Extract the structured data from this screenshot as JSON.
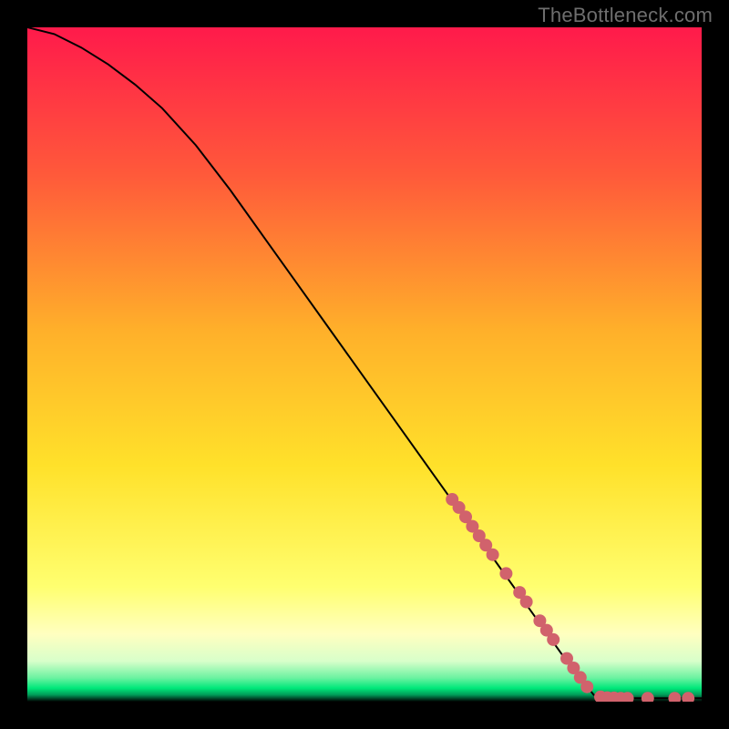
{
  "watermark": "TheBottleneck.com",
  "chart_data": {
    "type": "line",
    "title": "",
    "xlabel": "",
    "ylabel": "",
    "xlim": [
      0,
      100
    ],
    "ylim": [
      0,
      100
    ],
    "grid": false,
    "background_gradient": {
      "top": "#ff1a4b",
      "upper_mid": "#ff8a2a",
      "mid": "#ffe12a",
      "lower_mid": "#ffff8a",
      "bottom_band": "#00e87a",
      "bottom_line": "#000000"
    },
    "curve": [
      {
        "x": 0,
        "y": 100
      },
      {
        "x": 4,
        "y": 99
      },
      {
        "x": 8,
        "y": 97
      },
      {
        "x": 12,
        "y": 94.5
      },
      {
        "x": 16,
        "y": 91.5
      },
      {
        "x": 20,
        "y": 88
      },
      {
        "x": 25,
        "y": 82.5
      },
      {
        "x": 30,
        "y": 76
      },
      {
        "x": 35,
        "y": 69
      },
      {
        "x": 40,
        "y": 62
      },
      {
        "x": 45,
        "y": 55
      },
      {
        "x": 50,
        "y": 48
      },
      {
        "x": 55,
        "y": 41
      },
      {
        "x": 60,
        "y": 34
      },
      {
        "x": 65,
        "y": 27
      },
      {
        "x": 70,
        "y": 20
      },
      {
        "x": 75,
        "y": 13
      },
      {
        "x": 80,
        "y": 6
      },
      {
        "x": 84,
        "y": 1
      },
      {
        "x": 86,
        "y": 0.5
      },
      {
        "x": 100,
        "y": 0.5
      }
    ],
    "marker_color": "#d1626c",
    "markers": [
      {
        "x": 63,
        "y": 30
      },
      {
        "x": 64,
        "y": 28.8
      },
      {
        "x": 65,
        "y": 27.4
      },
      {
        "x": 66,
        "y": 26
      },
      {
        "x": 67,
        "y": 24.6
      },
      {
        "x": 68,
        "y": 23.2
      },
      {
        "x": 69,
        "y": 21.8
      },
      {
        "x": 71,
        "y": 19
      },
      {
        "x": 73,
        "y": 16.2
      },
      {
        "x": 74,
        "y": 14.8
      },
      {
        "x": 76,
        "y": 12
      },
      {
        "x": 77,
        "y": 10.6
      },
      {
        "x": 78,
        "y": 9.2
      },
      {
        "x": 80,
        "y": 6.4
      },
      {
        "x": 81,
        "y": 5
      },
      {
        "x": 82,
        "y": 3.6
      },
      {
        "x": 83,
        "y": 2.2
      },
      {
        "x": 85,
        "y": 0.7
      },
      {
        "x": 86,
        "y": 0.6
      },
      {
        "x": 87,
        "y": 0.55
      },
      {
        "x": 88,
        "y": 0.5
      },
      {
        "x": 89,
        "y": 0.5
      },
      {
        "x": 92,
        "y": 0.5
      },
      {
        "x": 96,
        "y": 0.5
      },
      {
        "x": 98,
        "y": 0.5
      }
    ]
  }
}
